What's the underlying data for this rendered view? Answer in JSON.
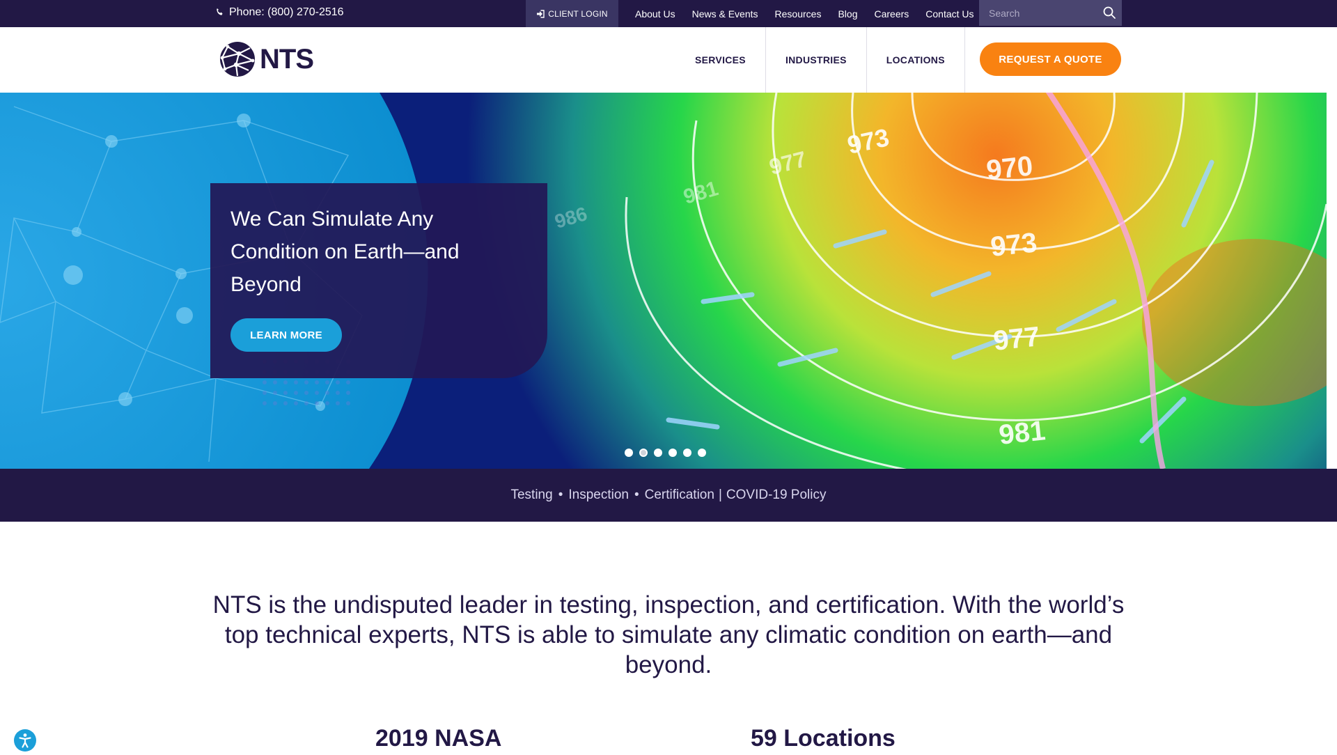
{
  "topbar": {
    "phone": "Phone: (800) 270-2516",
    "client_login": "CLIENT LOGIN",
    "util_nav": [
      "About Us",
      "News & Events",
      "Resources",
      "Blog",
      "Careers",
      "Contact Us"
    ],
    "search_placeholder": "Search"
  },
  "header": {
    "logo_text": "NTS",
    "nav": [
      "SERVICES",
      "INDUSTRIES",
      "LOCATIONS"
    ],
    "cta": "REQUEST A QUOTE"
  },
  "hero": {
    "title": "We Can Simulate Any Condition on Earth—and Beyond",
    "button": "LEARN MORE",
    "slide_count": 6,
    "active_slide": 2,
    "map_labels": [
      "973",
      "977",
      "981",
      "986",
      "970",
      "973",
      "977",
      "981"
    ]
  },
  "band": {
    "items": [
      "Testing",
      "Inspection",
      "Certification"
    ],
    "policy": "COVID-19 Policy"
  },
  "intro": "NTS is the undisputed leader in testing, inspection, and certification. With the world’s top technical experts, NTS is able to simulate any climatic condition on earth—and beyond.",
  "stats": [
    "2019 NASA",
    "59 Locations"
  ],
  "colors": {
    "navy": "#221845",
    "orange": "#f98211",
    "blue": "#1b9fd9"
  }
}
